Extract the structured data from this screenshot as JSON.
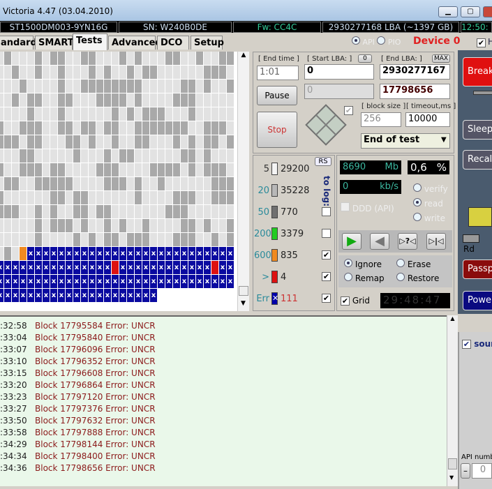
{
  "window": {
    "title": "Victoria 4.47 (03.04.2010)"
  },
  "infobar": {
    "model": "ST1500DM003-9YN16G",
    "serial": "SN: W240B0DE",
    "firmware": "Fw: CC4C",
    "capacity": "2930277168 LBA (~1397 GB)",
    "clock": "12:50:"
  },
  "tabs": [
    "andard",
    "SMART",
    "Tests",
    "Advanced",
    "DCO",
    "Setup"
  ],
  "active_tab": "Tests",
  "mode": {
    "api": "API",
    "pio": "PIO",
    "device": "Device 0",
    "h_label": "H"
  },
  "controls": {
    "end_time_label": "[ End time ]",
    "end_time": "1:01",
    "start_lba_label": "[ Start LBA: ]",
    "start_zero_btn": "0",
    "start_lba": "0",
    "current_lba": "0",
    "end_lba_label": "[ End LBA: ]",
    "max_btn": "MAX",
    "end_lba": "2930277167",
    "position": "17798656",
    "pause": "Pause",
    "stop": "Stop",
    "block_size_label": "[ block size ]",
    "block_size": "256",
    "timeout_label": "[ timeout,ms ]",
    "timeout": "10000",
    "end_action": "End of test"
  },
  "stats": {
    "rs": "RS",
    "to_log": "to log:",
    "rows": [
      {
        "ms": "5",
        "count": "29200",
        "color": "#f4f4f4",
        "log": null
      },
      {
        "ms": "20",
        "count": "35228",
        "color": "#b8b8b8",
        "log": null
      },
      {
        "ms": "50",
        "count": "770",
        "color": "#707070",
        "log": false
      },
      {
        "ms": "200",
        "count": "3379",
        "color": "#22cc22",
        "log": false
      },
      {
        "ms": "600",
        "count": "835",
        "color": "#f08a20",
        "log": true
      },
      {
        "ms": ">",
        "count": "4",
        "color": "#dd1111",
        "log": true
      },
      {
        "ms": "Err",
        "count": "111",
        "color": "#0000aa",
        "log": true
      }
    ]
  },
  "progress": {
    "mb": "8690",
    "mb_unit": "Mb",
    "percent": "0,6",
    "percent_unit": "%",
    "speed": "0",
    "speed_unit": "kb/s",
    "ddd": "DDD (API)",
    "modes": [
      "verify",
      "read",
      "write"
    ],
    "selected_mode": "read",
    "actions": [
      "Ignore",
      "Erase",
      "Remap",
      "Restore"
    ],
    "selected_action": "Ignore",
    "grid_label": "Grid",
    "timer": "29:48:47"
  },
  "right": {
    "break": "Break All",
    "sleep": "Sleep",
    "recalibrate": "Recall",
    "rd": "Rd",
    "passport": "Passp",
    "power": "Power",
    "sound": "sound",
    "api_number": "API numb",
    "api_value": "0",
    "minus": "–"
  },
  "log": [
    {
      "t": ":32:58",
      "m": "Block 17795584 Error: UNCR"
    },
    {
      "t": ":33:04",
      "m": "Block 17795840 Error: UNCR"
    },
    {
      "t": ":33:07",
      "m": "Block 17796096 Error: UNCR"
    },
    {
      "t": ":33:10",
      "m": "Block 17796352 Error: UNCR"
    },
    {
      "t": ":33:15",
      "m": "Block 17796608 Error: UNCR"
    },
    {
      "t": ":33:20",
      "m": "Block 17796864 Error: UNCR"
    },
    {
      "t": ":33:23",
      "m": "Block 17797120 Error: UNCR"
    },
    {
      "t": ":33:27",
      "m": "Block 17797376 Error: UNCR"
    },
    {
      "t": ":33:50",
      "m": "Block 17797632 Error: UNCR"
    },
    {
      "t": ":33:58",
      "m": "Block 17797888 Error: UNCR"
    },
    {
      "t": ":34:29",
      "m": "Block 17798144 Error: UNCR"
    },
    {
      "t": ":34:34",
      "m": "Block 17798400 Error: UNCR"
    },
    {
      "t": ":34:36",
      "m": "Block 17798656 Error: UNCR"
    }
  ]
}
